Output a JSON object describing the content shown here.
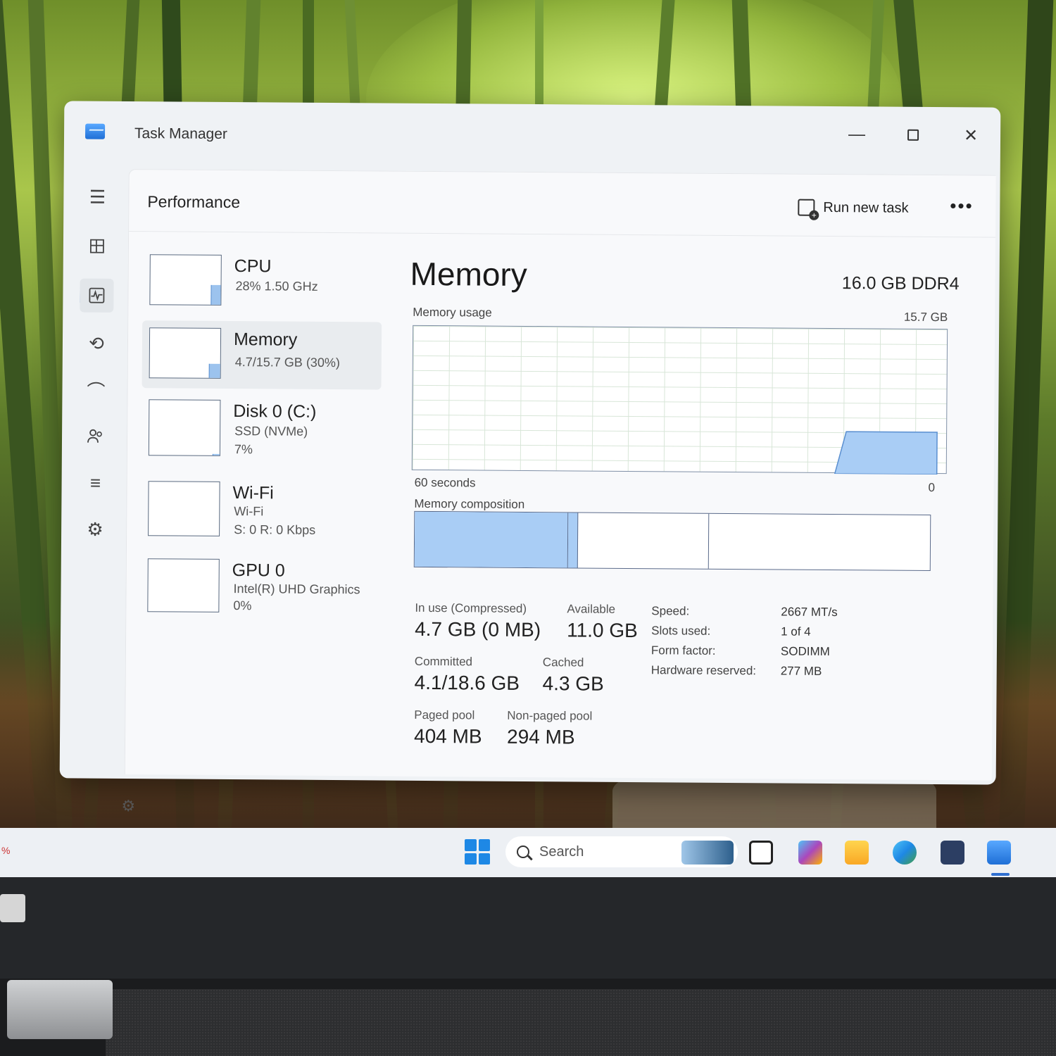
{
  "window": {
    "title": "Task Manager",
    "controls": {
      "minimize": "—",
      "close": "✕"
    }
  },
  "header": {
    "page_title": "Performance",
    "run_new_task": "Run new task",
    "more": "•••"
  },
  "nav": {
    "items": [
      "menu-icon",
      "processes-icon",
      "performance-icon",
      "app-history-icon",
      "startup-apps-icon",
      "users-icon",
      "details-icon",
      "services-icon"
    ],
    "settings": "settings-icon",
    "active": "performance-icon"
  },
  "devices": [
    {
      "name": "CPU",
      "sub1": "28%  1.50 GHz",
      "sub2": ""
    },
    {
      "name": "Memory",
      "sub1": "4.7/15.7 GB (30%)",
      "sub2": ""
    },
    {
      "name": "Disk 0 (C:)",
      "sub1": "SSD (NVMe)",
      "sub2": "7%"
    },
    {
      "name": "Wi-Fi",
      "sub1": "Wi-Fi",
      "sub2": "S: 0  R: 0 Kbps"
    },
    {
      "name": "GPU 0",
      "sub1": "Intel(R) UHD Graphics",
      "sub2": "0%"
    }
  ],
  "memory": {
    "title": "Memory",
    "spec": "16.0 GB DDR4",
    "usage_label": "Memory usage",
    "usage_max": "15.7 GB",
    "time_left": "60 seconds",
    "time_right": "0",
    "composition_label": "Memory composition",
    "in_use_label": "In use (Compressed)",
    "in_use_value": "4.7 GB (0 MB)",
    "available_label": "Available",
    "available_value": "11.0 GB",
    "committed_label": "Committed",
    "committed_value": "4.1/18.6 GB",
    "cached_label": "Cached",
    "cached_value": "4.3 GB",
    "paged_label": "Paged pool",
    "paged_value": "404 MB",
    "nonpaged_label": "Non-paged pool",
    "nonpaged_value": "294 MB",
    "specs": [
      {
        "k": "Speed:",
        "v": "2667 MT/s"
      },
      {
        "k": "Slots used:",
        "v": "1 of 4"
      },
      {
        "k": "Form factor:",
        "v": "SODIMM"
      },
      {
        "k": "Hardware reserved:",
        "v": "277 MB"
      }
    ]
  },
  "taskbar": {
    "left_fragment": "%",
    "search_placeholder": "Search",
    "icons": [
      "start-icon",
      "search-icon",
      "widgets-icon",
      "task-view-icon",
      "m365-copilot-icon",
      "file-explorer-icon",
      "edge-icon",
      "store-icon",
      "task-manager-icon"
    ]
  },
  "colors": {
    "accent": "#2f6fd0",
    "graph_fill": "#9cc3ee",
    "window_bg": "#eff2f5"
  }
}
